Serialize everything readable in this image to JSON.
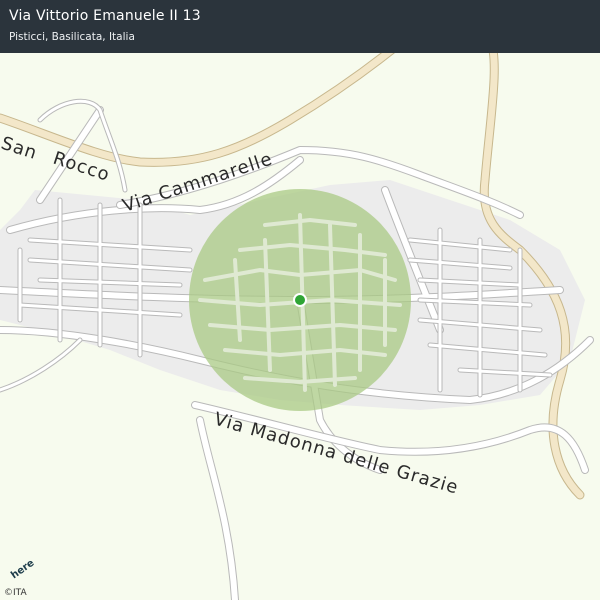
{
  "header": {
    "title": "Via Vittorio Emanuele II 13",
    "subtitle": "Pisticci, Basilicata, Italia"
  },
  "map": {
    "streets": [
      {
        "id": "rocco",
        "name": "Rocco"
      },
      {
        "id": "san",
        "name": "San"
      },
      {
        "id": "cammarelle",
        "name": "Via Cammarelle"
      },
      {
        "id": "grazie",
        "name": "Via Madonna delle Grazie"
      }
    ],
    "colors": {
      "land": "#f7fbee",
      "road_fill": "#ffffff",
      "road_casing": "#b9b9b9",
      "built_area": "#ececec",
      "radius_fill": "#a9ca84",
      "location_dot": "#2fa535",
      "highway": "#f3e7c9"
    },
    "location_marker": "location-dot",
    "accuracy_radius": "accuracy-circle"
  },
  "footer": {
    "logo_text": "here",
    "copyright": "©ITA"
  }
}
